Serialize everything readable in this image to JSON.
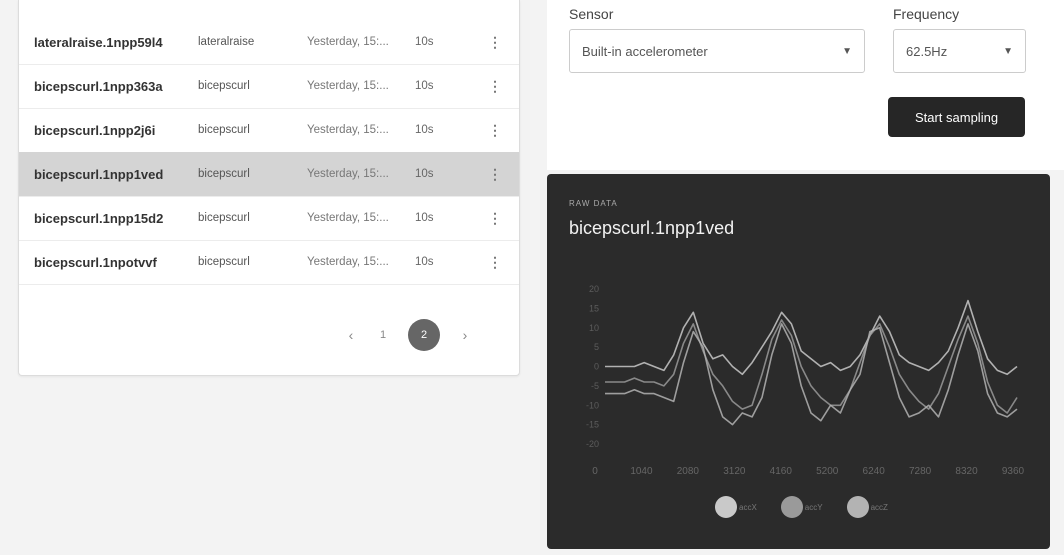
{
  "samples": [
    {
      "name": "lateralraise.1npp59l4",
      "label": "lateralraise",
      "date": "Yesterday, 15:...",
      "length": "10s"
    },
    {
      "name": "bicepscurl.1npp363a",
      "label": "bicepscurl",
      "date": "Yesterday, 15:...",
      "length": "10s"
    },
    {
      "name": "bicepscurl.1npp2j6i",
      "label": "bicepscurl",
      "date": "Yesterday, 15:...",
      "length": "10s"
    },
    {
      "name": "bicepscurl.1npp1ved",
      "label": "bicepscurl",
      "date": "Yesterday, 15:...",
      "length": "10s",
      "selected": true
    },
    {
      "name": "bicepscurl.1npp15d2",
      "label": "bicepscurl",
      "date": "Yesterday, 15:...",
      "length": "10s"
    },
    {
      "name": "bicepscurl.1npotvvf",
      "label": "bicepscurl",
      "date": "Yesterday, 15:...",
      "length": "10s"
    }
  ],
  "pagination": {
    "prev": "‹",
    "pages": [
      "1",
      "2"
    ],
    "current": "2",
    "next": "›"
  },
  "sensor_form": {
    "sensor_label": "Sensor",
    "sensor_value": "Built-in accelerometer",
    "frequency_label": "Frequency",
    "frequency_value": "62.5Hz",
    "start_button": "Start sampling"
  },
  "raw_data": {
    "kicker": "RAW DATA",
    "title": "bicepscurl.1npp1ved"
  },
  "icons": {
    "menu": "vertical-ellipsis-icon",
    "chevron": "chevron-down-icon"
  },
  "colors": {
    "selected_row": "#d4d4d4",
    "button": "#262626",
    "chart_bg": "#2b2b2b",
    "pager_current": "#666666"
  },
  "chart_data": {
    "type": "line",
    "xticks": [
      "0",
      "1040",
      "2080",
      "3120",
      "4160",
      "5200",
      "6240",
      "7280",
      "8320",
      "9360"
    ],
    "yticks": [
      "20",
      "15",
      "10",
      "5",
      "0",
      "-5",
      "-10",
      "-15",
      "-20"
    ],
    "xlim": [
      0,
      10000
    ],
    "ylim": [
      -20,
      20
    ],
    "grid": false,
    "legend_position": "bottom",
    "series": [
      {
        "name": "accX",
        "color": "#c9c9c9",
        "values": [
          0,
          0,
          0,
          0,
          1,
          0,
          -1,
          3,
          10,
          14,
          6,
          2,
          3,
          0,
          -2,
          1,
          5,
          9,
          14,
          11,
          4,
          2,
          0,
          1,
          -1,
          0,
          3,
          8,
          13,
          9,
          3,
          1,
          0,
          -1,
          1,
          4,
          10,
          17,
          9,
          2,
          -1,
          -2,
          0
        ]
      },
      {
        "name": "accY",
        "color": "#9a9a9a",
        "values": [
          -4,
          -4,
          -4,
          -3,
          -4,
          -4,
          -5,
          -2,
          6,
          11,
          4,
          -2,
          -5,
          -9,
          -11,
          -10,
          -2,
          7,
          12,
          8,
          0,
          -5,
          -8,
          -10,
          -10,
          -6,
          1,
          8,
          11,
          5,
          -2,
          -6,
          -9,
          -11,
          -7,
          0,
          7,
          13,
          6,
          -4,
          -10,
          -12,
          -8
        ]
      },
      {
        "name": "accZ",
        "color": "#b3b3b3",
        "values": [
          -7,
          -7,
          -7,
          -6,
          -7,
          -7,
          -8,
          -9,
          1,
          9,
          5,
          -6,
          -13,
          -15,
          -12,
          -13,
          -8,
          3,
          11,
          6,
          -5,
          -12,
          -14,
          -10,
          -12,
          -6,
          -2,
          9,
          10,
          1,
          -8,
          -13,
          -12,
          -10,
          -13,
          -6,
          3,
          11,
          4,
          -7,
          -12,
          -13,
          -11
        ]
      }
    ]
  }
}
